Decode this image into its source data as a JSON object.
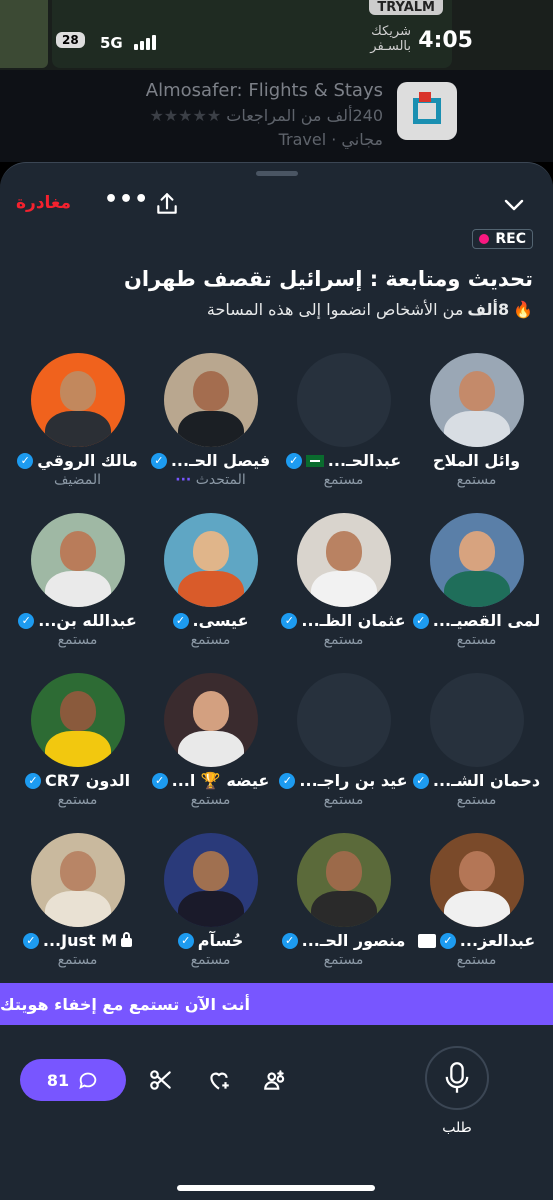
{
  "status_bar": {
    "time": "4:05",
    "network": "5G",
    "battery": "28",
    "background_brand": "TRYALM",
    "background_text_1": "شريكك",
    "background_text_2": "بالسـفر"
  },
  "ad": {
    "title": "Almosafer: Flights & Stays",
    "reviews": "240ألف من المراجعات",
    "stars": "★★★★★",
    "category": "مجاني · Travel"
  },
  "space": {
    "leave_label": "مغادرة",
    "more_label": "•••",
    "rec_label": "REC",
    "title": "تحديث ومتابعة : إسرائيل تقصف طهران",
    "joined_count": "8ألف",
    "joined_text": "من الأشخاص انضموا إلى هذه المساحة",
    "flame_icon": "🔥"
  },
  "participants": [
    {
      "name": "وائل الملاح",
      "role": "مستمع",
      "verified": false
    },
    {
      "name": "عبدالحـ...",
      "role": "مستمع",
      "verified": true,
      "flag": true
    },
    {
      "name": "فيصل الحـ...",
      "role": "المتحدث",
      "verified": true
    },
    {
      "name": "مالك الروقي",
      "role": "المضيف",
      "verified": true
    },
    {
      "name": "لمى القصيـ...",
      "role": "مستمع",
      "verified": true
    },
    {
      "name": "عثمان الظـ...",
      "role": "مستمع",
      "verified": true
    },
    {
      "name": "عيسى.",
      "role": "مستمع",
      "verified": true
    },
    {
      "name": "عبدالله بن...",
      "role": "مستمع",
      "verified": true
    },
    {
      "name": "دحمان الشـ...",
      "role": "مستمع",
      "verified": true
    },
    {
      "name": "عيد بن راجـ...",
      "role": "مستمع",
      "verified": true
    },
    {
      "name": "عيضه 🏆 ا...",
      "role": "مستمع",
      "verified": true
    },
    {
      "name": "الدون CR7",
      "role": "مستمع",
      "verified": true
    },
    {
      "name": "عبدالعز...",
      "role": "مستمع",
      "verified": true
    },
    {
      "name": "منصور الحـ...",
      "role": "مستمع",
      "verified": true
    },
    {
      "name": "حُسآم",
      "role": "مستمع",
      "verified": true
    },
    {
      "name": "Just M...",
      "role": "مستمع",
      "verified": true
    }
  ],
  "banner": "أنت الآن تستمع مع إخفاء هويتك",
  "bottom": {
    "reply_count": "81",
    "request_label": "طلب"
  },
  "colors": {
    "sheet_bg": "#1e2732",
    "accent_purple": "#7856ff",
    "leave_red": "#f4212e",
    "verified_blue": "#1d9bf0"
  }
}
